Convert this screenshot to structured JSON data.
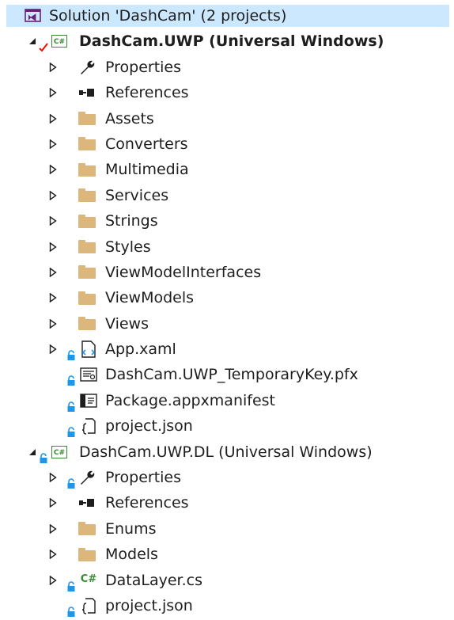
{
  "solution_explorer": {
    "solution": {
      "label": "Solution 'DashCam' (2 projects)",
      "icon": "vs-solution-icon"
    },
    "projects": [
      {
        "label": "DashCam.UWP (Universal Windows)",
        "icon": "csharp-project-icon",
        "startup": true,
        "items": [
          {
            "label": "Properties",
            "icon": "wrench-icon"
          },
          {
            "label": "References",
            "icon": "references-icon"
          },
          {
            "label": "Assets",
            "icon": "folder-icon"
          },
          {
            "label": "Converters",
            "icon": "folder-icon"
          },
          {
            "label": "Multimedia",
            "icon": "folder-icon"
          },
          {
            "label": "Services",
            "icon": "folder-icon"
          },
          {
            "label": "Strings",
            "icon": "folder-icon"
          },
          {
            "label": "Styles",
            "icon": "folder-icon"
          },
          {
            "label": "ViewModelInterfaces",
            "icon": "folder-icon"
          },
          {
            "label": "ViewModels",
            "icon": "folder-icon"
          },
          {
            "label": "Views",
            "icon": "folder-icon"
          },
          {
            "label": "App.xaml",
            "icon": "xaml-file-icon"
          },
          {
            "label": "DashCam.UWP_TemporaryKey.pfx",
            "icon": "certificate-file-icon"
          },
          {
            "label": "Package.appxmanifest",
            "icon": "manifest-file-icon"
          },
          {
            "label": "project.json",
            "icon": "json-file-icon"
          }
        ]
      },
      {
        "label": "DashCam.UWP.DL (Universal Windows)",
        "icon": "csharp-project-icon",
        "startup": false,
        "items": [
          {
            "label": "Properties",
            "icon": "wrench-icon"
          },
          {
            "label": "References",
            "icon": "references-icon"
          },
          {
            "label": "Enums",
            "icon": "folder-icon"
          },
          {
            "label": "Models",
            "icon": "folder-icon"
          },
          {
            "label": "DataLayer.cs",
            "icon": "csharp-file-icon"
          },
          {
            "label": "project.json",
            "icon": "json-file-icon"
          }
        ]
      }
    ],
    "colors": {
      "selection": "#cce8ff",
      "folder": "#dcb67a",
      "csharp_green": "#388a34",
      "lock_blue": "#1c97ea",
      "check_red": "#e51400",
      "solution_purple": "#68217a"
    }
  }
}
